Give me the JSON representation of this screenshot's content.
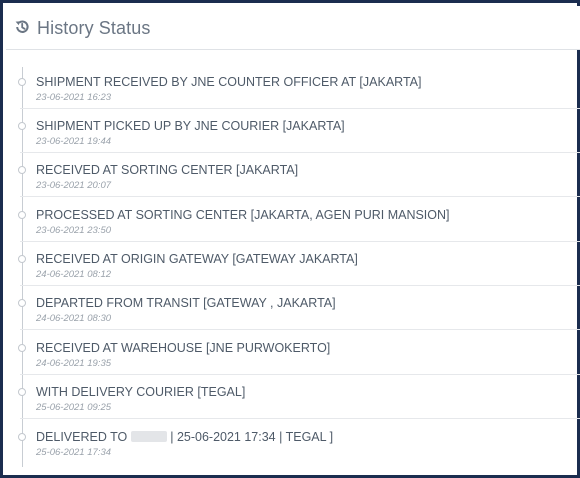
{
  "header": {
    "title": "History Status",
    "icon": "history-icon"
  },
  "colors": {
    "border": "#1b2d4f",
    "text": "#4e5a68",
    "date": "#9aa2ab",
    "timeline": "#c8cdd3"
  },
  "events": [
    {
      "status": "SHIPMENT RECEIVED BY JNE COUNTER OFFICER AT [JAKARTA]",
      "date": "23-06-2021 16:23"
    },
    {
      "status": "SHIPMENT PICKED UP BY JNE COURIER [JAKARTA]",
      "date": "23-06-2021 19:44"
    },
    {
      "status": "RECEIVED AT SORTING CENTER [JAKARTA]",
      "date": "23-06-2021 20:07"
    },
    {
      "status": "PROCESSED AT SORTING CENTER [JAKARTA, AGEN PURI MANSION]",
      "date": "23-06-2021 23:50"
    },
    {
      "status": "RECEIVED AT ORIGIN GATEWAY [GATEWAY JAKARTA]",
      "date": "24-06-2021 08:12"
    },
    {
      "status": "DEPARTED FROM TRANSIT [GATEWAY , JAKARTA]",
      "date": "24-06-2021 08:30"
    },
    {
      "status": "RECEIVED AT WAREHOUSE [JNE PURWOKERTO]",
      "date": "24-06-2021 19:35"
    },
    {
      "status": "WITH DELIVERY COURIER [TEGAL]",
      "date": "25-06-2021 09:25"
    },
    {
      "status_prefix": "DELIVERED TO",
      "status_suffix": "| 25-06-2021 17:34 | TEGAL ]",
      "date": "25-06-2021 17:34"
    }
  ]
}
